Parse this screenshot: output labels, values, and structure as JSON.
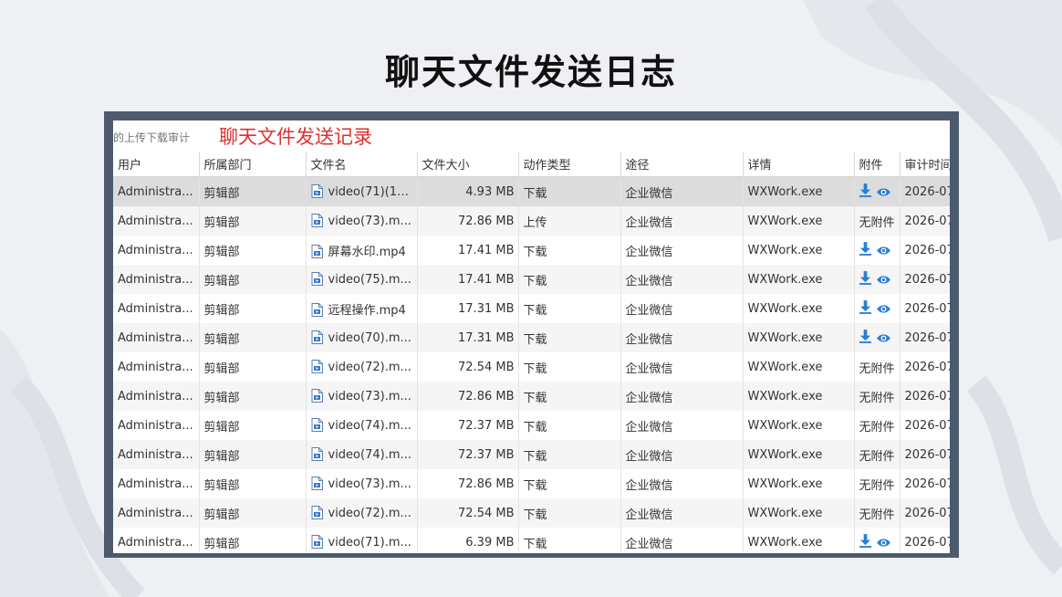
{
  "slide": {
    "title": "聊天文件发送日志"
  },
  "window": {
    "tab_fragment": "的上传下载审计",
    "red_heading": "聊天文件发送记录"
  },
  "table": {
    "columns": [
      "用户",
      "所属部门",
      "文件名",
      "文件大小",
      "动作类型",
      "途径",
      "详情",
      "附件",
      "审计时间"
    ],
    "rows": [
      {
        "user": "Administra...",
        "dept": "剪辑部",
        "file": "video(71)(1)....",
        "size": "4.93 MB",
        "action": "下载",
        "channel": "企业微信",
        "detail": "WXWork.exe",
        "attachment": "icons",
        "time": "2026-07",
        "selected": true
      },
      {
        "user": "Administra...",
        "dept": "剪辑部",
        "file": "video(73).m...",
        "size": "72.86 MB",
        "action": "上传",
        "channel": "企业微信",
        "detail": "WXWork.exe",
        "attachment": "无附件",
        "time": "2026-07"
      },
      {
        "user": "Administra...",
        "dept": "剪辑部",
        "file": "屏幕水印.mp4",
        "size": "17.41 MB",
        "action": "下载",
        "channel": "企业微信",
        "detail": "WXWork.exe",
        "attachment": "icons",
        "time": "2026-07"
      },
      {
        "user": "Administra...",
        "dept": "剪辑部",
        "file": "video(75).m...",
        "size": "17.41 MB",
        "action": "下载",
        "channel": "企业微信",
        "detail": "WXWork.exe",
        "attachment": "icons",
        "time": "2026-07"
      },
      {
        "user": "Administra...",
        "dept": "剪辑部",
        "file": "远程操作.mp4",
        "size": "17.31 MB",
        "action": "下载",
        "channel": "企业微信",
        "detail": "WXWork.exe",
        "attachment": "icons",
        "time": "2026-07"
      },
      {
        "user": "Administra...",
        "dept": "剪辑部",
        "file": "video(70).m...",
        "size": "17.31 MB",
        "action": "下载",
        "channel": "企业微信",
        "detail": "WXWork.exe",
        "attachment": "icons",
        "time": "2026-07"
      },
      {
        "user": "Administra...",
        "dept": "剪辑部",
        "file": "video(72).m...",
        "size": "72.54 MB",
        "action": "下载",
        "channel": "企业微信",
        "detail": "WXWork.exe",
        "attachment": "无附件",
        "time": "2026-07"
      },
      {
        "user": "Administra...",
        "dept": "剪辑部",
        "file": "video(73).m...",
        "size": "72.86 MB",
        "action": "下载",
        "channel": "企业微信",
        "detail": "WXWork.exe",
        "attachment": "无附件",
        "time": "2026-07"
      },
      {
        "user": "Administra...",
        "dept": "剪辑部",
        "file": "video(74).m...",
        "size": "72.37 MB",
        "action": "下载",
        "channel": "企业微信",
        "detail": "WXWork.exe",
        "attachment": "无附件",
        "time": "2026-07"
      },
      {
        "user": "Administra...",
        "dept": "剪辑部",
        "file": "video(74).m...",
        "size": "72.37 MB",
        "action": "下载",
        "channel": "企业微信",
        "detail": "WXWork.exe",
        "attachment": "无附件",
        "time": "2026-07"
      },
      {
        "user": "Administra...",
        "dept": "剪辑部",
        "file": "video(73).m...",
        "size": "72.86 MB",
        "action": "下载",
        "channel": "企业微信",
        "detail": "WXWork.exe",
        "attachment": "无附件",
        "time": "2026-07"
      },
      {
        "user": "Administra...",
        "dept": "剪辑部",
        "file": "video(72).m...",
        "size": "72.54 MB",
        "action": "下载",
        "channel": "企业微信",
        "detail": "WXWork.exe",
        "attachment": "无附件",
        "time": "2026-07"
      },
      {
        "user": "Administra...",
        "dept": "剪辑部",
        "file": "video(71).m...",
        "size": "6.39 MB",
        "action": "下载",
        "channel": "企业微信",
        "detail": "WXWork.exe",
        "attachment": "icons",
        "time": "2026-07"
      }
    ]
  },
  "icons": {
    "file": "video-file-icon",
    "download": "download-icon",
    "preview": "eye-icon"
  },
  "colors": {
    "frame": "#4d5a6e",
    "heading_red": "#e03030",
    "icon_blue": "#2a7fd4",
    "selected_row": "#dcdcdc"
  }
}
